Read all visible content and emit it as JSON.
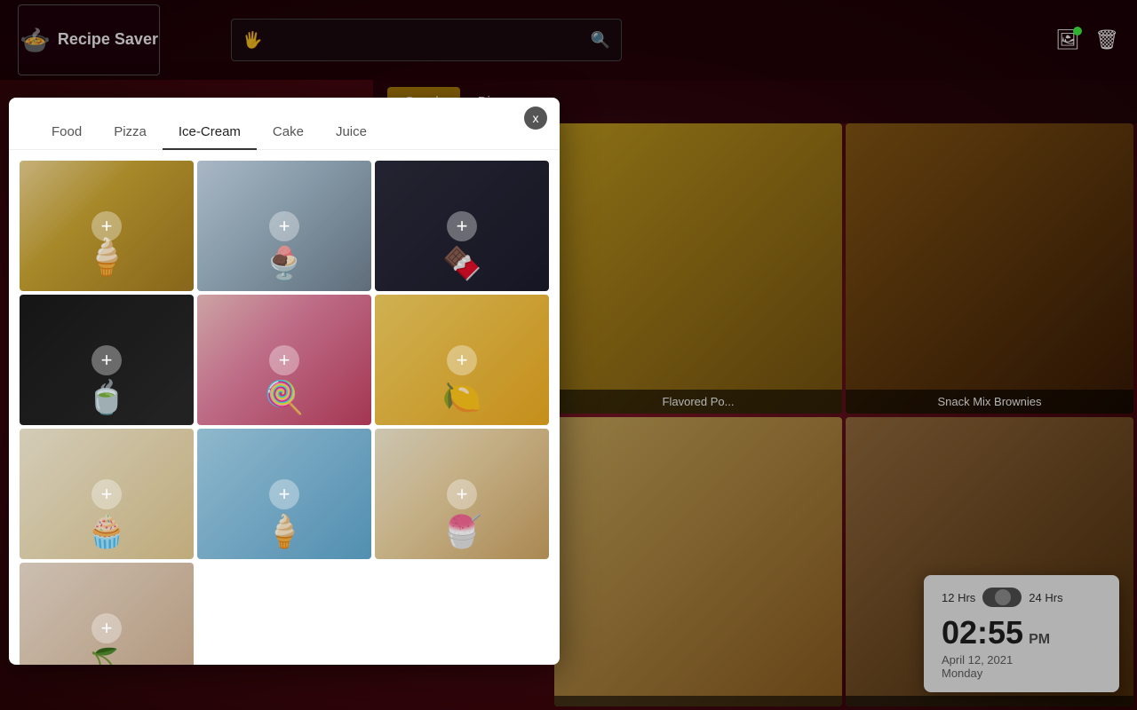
{
  "app": {
    "name": "Recipe Saver",
    "logo_icon": "🍲"
  },
  "search": {
    "placeholder": "",
    "value": ""
  },
  "main_tabs": [
    {
      "id": "snack",
      "label": "Snack",
      "active": true
    },
    {
      "id": "dinner",
      "label": "Dinner",
      "active": false
    }
  ],
  "modal": {
    "close_label": "x",
    "tabs": [
      {
        "id": "food",
        "label": "Food",
        "active": false
      },
      {
        "id": "pizza",
        "label": "Pizza",
        "active": false
      },
      {
        "id": "ice-cream",
        "label": "Ice-Cream",
        "active": true
      },
      {
        "id": "cake",
        "label": "Cake",
        "active": false
      },
      {
        "id": "juice",
        "label": "Juice",
        "active": false
      }
    ],
    "images": [
      {
        "id": 1,
        "class": "ic1",
        "alt": "Colorful ice cream display"
      },
      {
        "id": 2,
        "class": "ic2",
        "alt": "Two cups of ice cream"
      },
      {
        "id": 3,
        "class": "ic3",
        "alt": "Dark chocolate ice cream"
      },
      {
        "id": 4,
        "class": "ic4",
        "alt": "Multiple ice cream scoops dark"
      },
      {
        "id": 5,
        "class": "ic5",
        "alt": "Pink popsicles with cherries"
      },
      {
        "id": 6,
        "class": "ic6",
        "alt": "Yellow mango ice cream"
      },
      {
        "id": 7,
        "class": "ic7",
        "alt": "Ice cream tray"
      },
      {
        "id": 8,
        "class": "ic8",
        "alt": "Ice cream cone in blue"
      },
      {
        "id": 9,
        "class": "ic9",
        "alt": "Colorful ice cream with flowers"
      },
      {
        "id": 10,
        "class": "ic10",
        "alt": "Pink ice cream"
      }
    ]
  },
  "bg_cards": [
    {
      "id": "popcorn",
      "label": "Flavored Po...",
      "class": "card-popcorn"
    },
    {
      "id": "brownies",
      "label": "Snack Mix Brownies",
      "class": "card-brownies"
    },
    {
      "id": "light-snack",
      "label": "",
      "class": "card-light"
    },
    {
      "id": "coconut",
      "label": "",
      "class": "card-coconut"
    }
  ],
  "clock": {
    "time": "02:55",
    "ampm": "PM",
    "date": "April 12, 2021",
    "day": "Monday",
    "toggle_12h": "12 Hrs",
    "toggle_24h": "24 Hrs"
  },
  "top_icons": {
    "gallery_icon": "🖼",
    "trash_icon": "🗑"
  }
}
